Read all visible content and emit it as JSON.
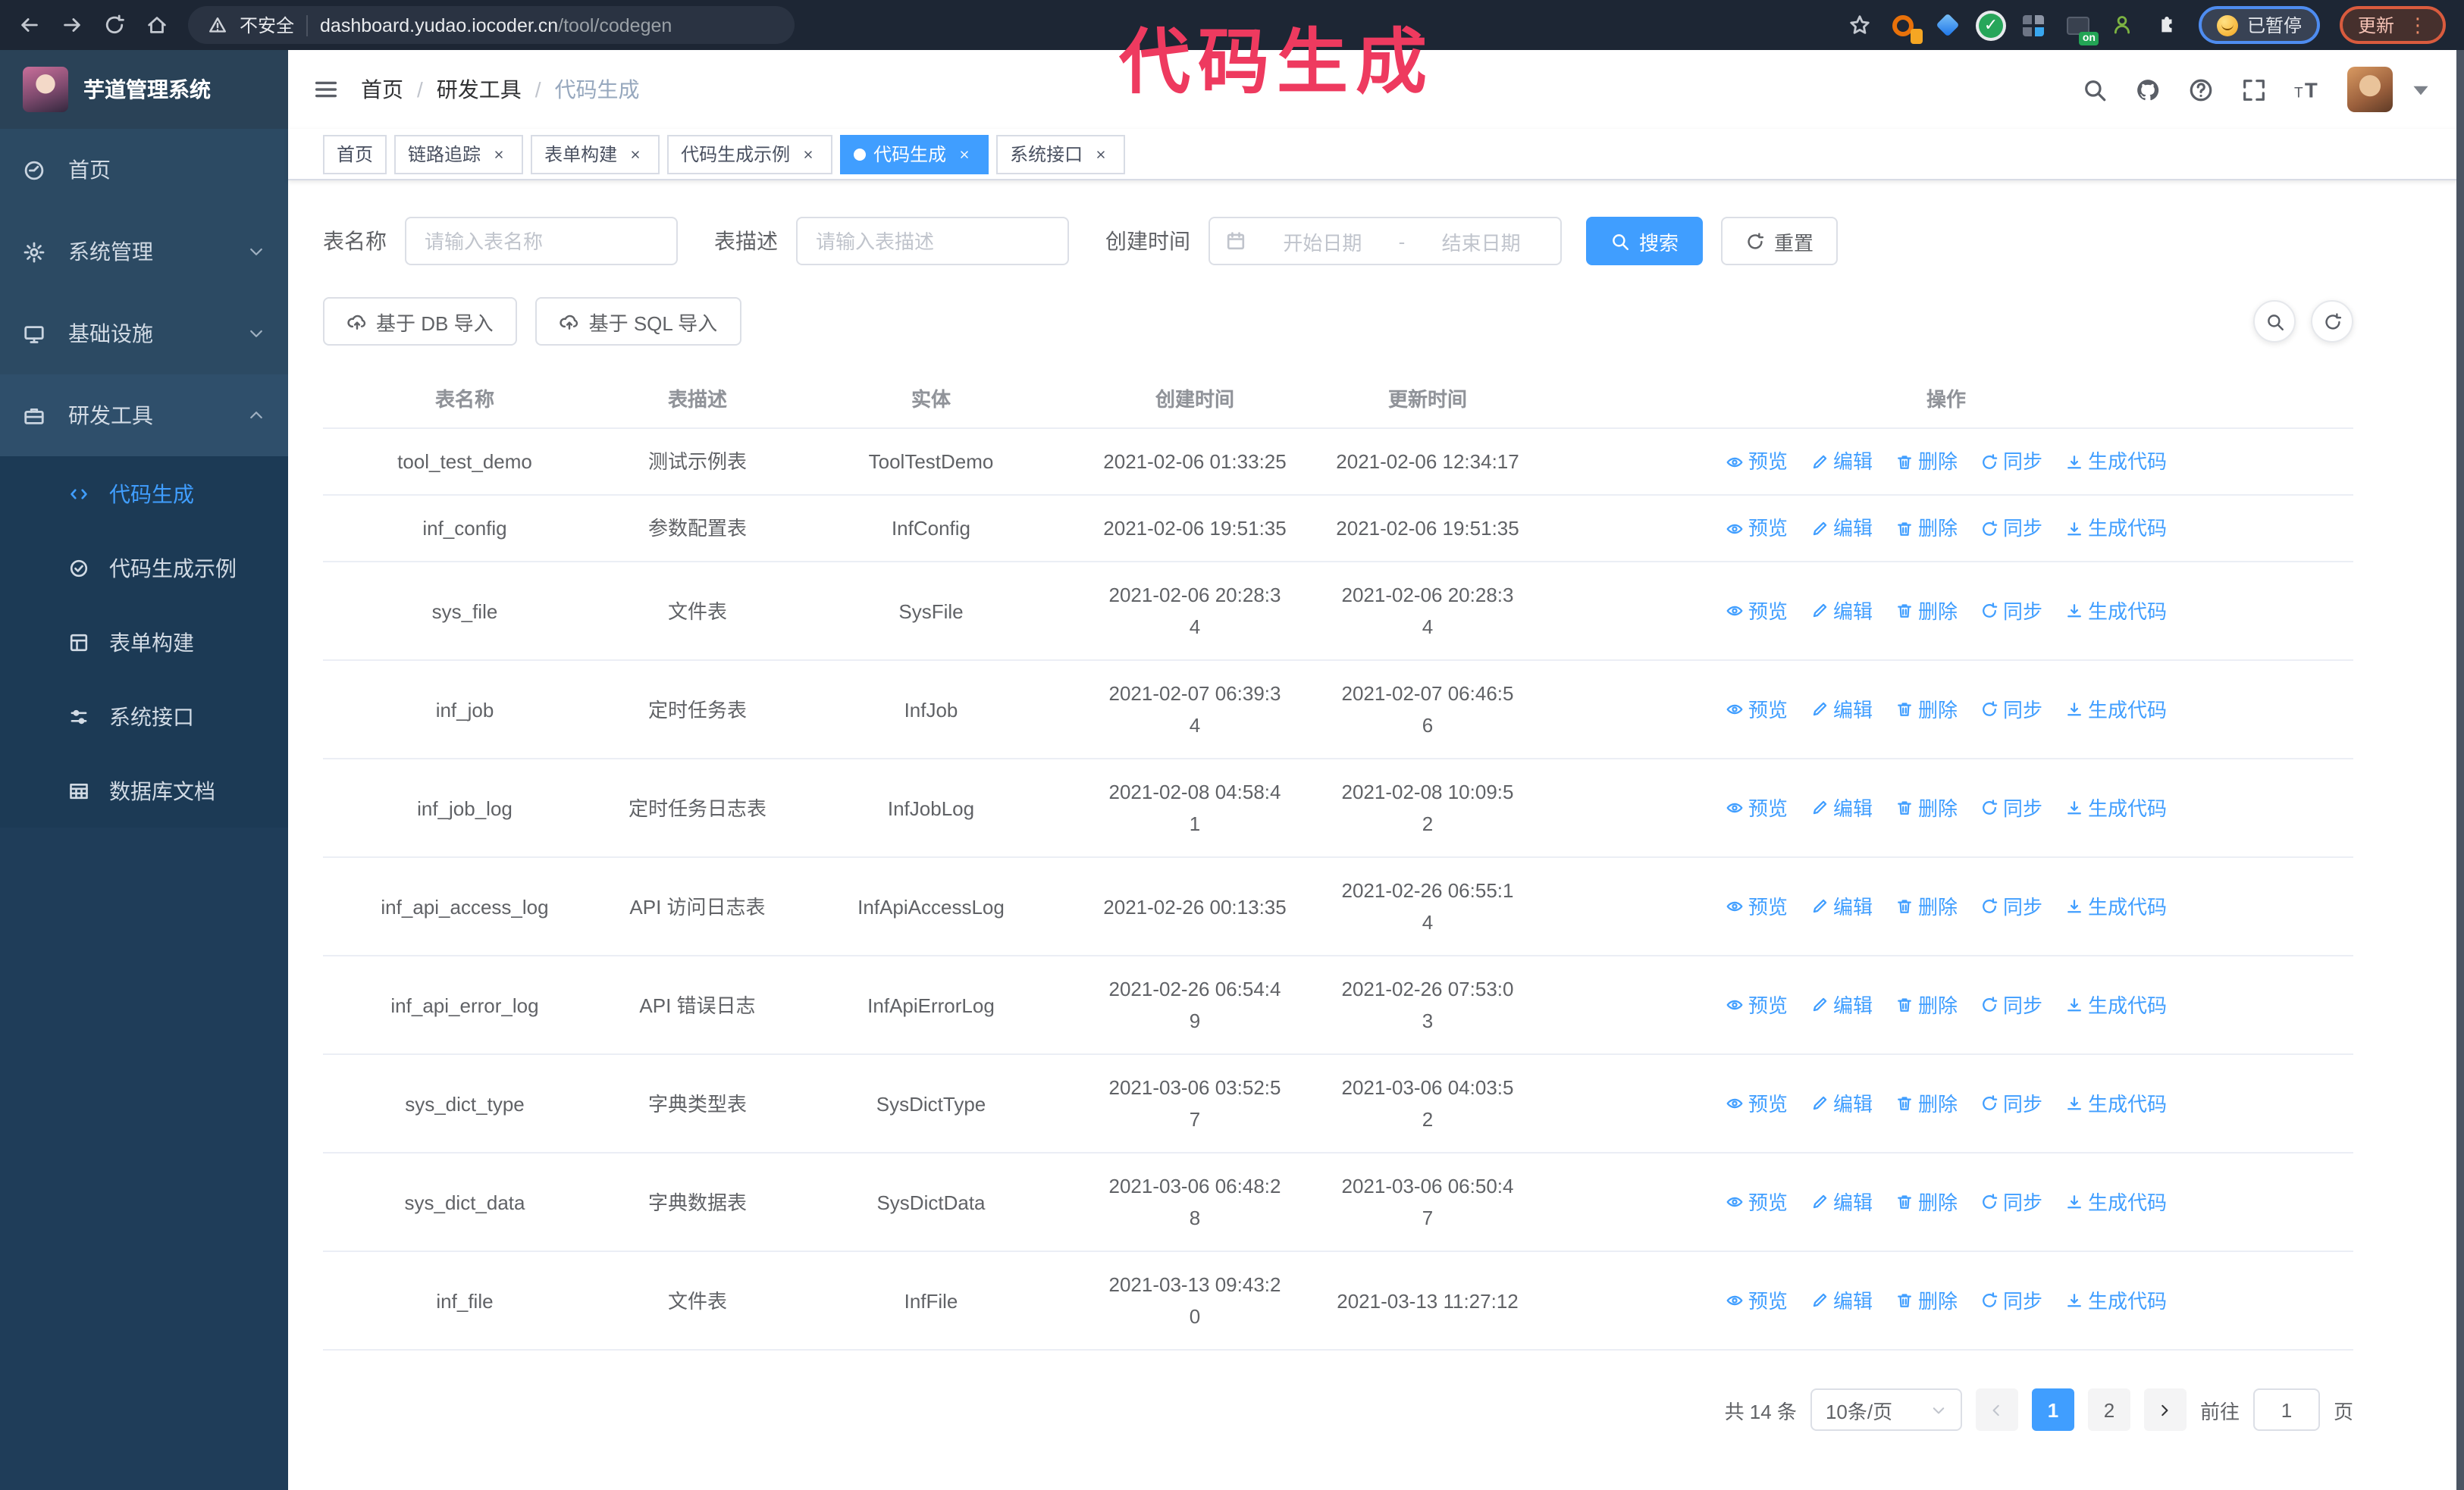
{
  "colors": {
    "accent": "#409eff",
    "sidebar_bg": "#2c4a63",
    "submenu_bg": "#1c3a55",
    "watermark": "#ee3a5f",
    "browser_bar": "#1d2634"
  },
  "watermark": {
    "text": "代码生成"
  },
  "browser": {
    "security_label": "不安全",
    "url_host": "dashboard.yudao.iocoder.cn",
    "url_path": "/tool/codegen",
    "extension_on_badge": "on",
    "paused_badge": "已暂停",
    "update_badge": "更新"
  },
  "app": {
    "title": "芋道管理系统",
    "breadcrumb": [
      "首页",
      "研发工具",
      "代码生成"
    ]
  },
  "sidebar": {
    "items": [
      {
        "key": "home",
        "label": "首页",
        "icon": "dashboard-icon",
        "chevron": ""
      },
      {
        "key": "system",
        "label": "系统管理",
        "icon": "gear-icon",
        "chevron": "down"
      },
      {
        "key": "infra",
        "label": "基础设施",
        "icon": "monitor-icon",
        "chevron": "down"
      },
      {
        "key": "devtools",
        "label": "研发工具",
        "icon": "toolbox-icon",
        "chevron": "up",
        "expanded": true
      }
    ],
    "submenu": [
      {
        "key": "codegen",
        "label": "代码生成",
        "icon": "code-icon",
        "active": true
      },
      {
        "key": "codegen-example",
        "label": "代码生成示例",
        "icon": "example-icon"
      },
      {
        "key": "form-builder",
        "label": "表单构建",
        "icon": "form-icon"
      },
      {
        "key": "system-api",
        "label": "系统接口",
        "icon": "api-icon"
      },
      {
        "key": "db-doc",
        "label": "数据库文档",
        "icon": "database-icon"
      }
    ]
  },
  "tag_bar": {
    "tags": [
      {
        "label": "首页",
        "closable": false,
        "active": false
      },
      {
        "label": "链路追踪",
        "closable": true,
        "active": false
      },
      {
        "label": "表单构建",
        "closable": true,
        "active": false
      },
      {
        "label": "代码生成示例",
        "closable": true,
        "active": false
      },
      {
        "label": "代码生成",
        "closable": true,
        "active": true
      },
      {
        "label": "系统接口",
        "closable": true,
        "active": false
      }
    ]
  },
  "search_form": {
    "fields": [
      {
        "label": "表名称",
        "placeholder": "请输入表名称"
      },
      {
        "label": "表描述",
        "placeholder": "请输入表描述"
      },
      {
        "label": "创建时间",
        "start_placeholder": "开始日期",
        "separator": "-",
        "end_placeholder": "结束日期"
      }
    ],
    "search_label": "搜索",
    "reset_label": "重置"
  },
  "toolbar": {
    "import_db_label": "基于 DB 导入",
    "import_sql_label": "基于 SQL 导入"
  },
  "table": {
    "columns": [
      "表名称",
      "表描述",
      "实体",
      "创建时间",
      "更新时间",
      "操作"
    ],
    "actions": [
      {
        "key": "preview",
        "label": "预览",
        "icon": "eye-icon"
      },
      {
        "key": "edit",
        "label": "编辑",
        "icon": "edit-icon"
      },
      {
        "key": "delete",
        "label": "删除",
        "icon": "delete-icon"
      },
      {
        "key": "sync",
        "label": "同步",
        "icon": "sync-icon"
      },
      {
        "key": "generate",
        "label": "生成代码",
        "icon": "download-icon"
      }
    ],
    "rows": [
      {
        "name": "tool_test_demo",
        "description": "测试示例表",
        "entity": "ToolTestDemo",
        "created": "2021-02-06 01:33:25",
        "updated": "2021-02-06 12:34:17"
      },
      {
        "name": "inf_config",
        "description": "参数配置表",
        "entity": "InfConfig",
        "created": "2021-02-06 19:51:35",
        "updated": "2021-02-06 19:51:35"
      },
      {
        "name": "sys_file",
        "description": "文件表",
        "entity": "SysFile",
        "created": "2021-02-06 20:28:3\n4",
        "updated": "2021-02-06 20:28:3\n4"
      },
      {
        "name": "inf_job",
        "description": "定时任务表",
        "entity": "InfJob",
        "created": "2021-02-07 06:39:3\n4",
        "updated": "2021-02-07 06:46:5\n6"
      },
      {
        "name": "inf_job_log",
        "description": "定时任务日志表",
        "entity": "InfJobLog",
        "created": "2021-02-08 04:58:4\n1",
        "updated": "2021-02-08 10:09:5\n2"
      },
      {
        "name": "inf_api_access_log",
        "description": "API 访问日志表",
        "entity": "InfApiAccessLog",
        "created": "2021-02-26 00:13:35",
        "updated": "2021-02-26 06:55:1\n4"
      },
      {
        "name": "inf_api_error_log",
        "description": "API 错误日志",
        "entity": "InfApiErrorLog",
        "created": "2021-02-26 06:54:4\n9",
        "updated": "2021-02-26 07:53:0\n3"
      },
      {
        "name": "sys_dict_type",
        "description": "字典类型表",
        "entity": "SysDictType",
        "created": "2021-03-06 03:52:5\n7",
        "updated": "2021-03-06 04:03:5\n2"
      },
      {
        "name": "sys_dict_data",
        "description": "字典数据表",
        "entity": "SysDictData",
        "created": "2021-03-06 06:48:2\n8",
        "updated": "2021-03-06 06:50:4\n7"
      },
      {
        "name": "inf_file",
        "description": "文件表",
        "entity": "InfFile",
        "created": "2021-03-13 09:43:2\n0",
        "updated": "2021-03-13 11:27:12"
      }
    ]
  },
  "pagination": {
    "total_label": "共 14 条",
    "page_size_label": "10条/页",
    "pages": [
      {
        "label": "1",
        "active": true
      },
      {
        "label": "2",
        "active": false
      }
    ],
    "goto_label": "前往",
    "goto_value": "1",
    "page_unit": "页"
  }
}
